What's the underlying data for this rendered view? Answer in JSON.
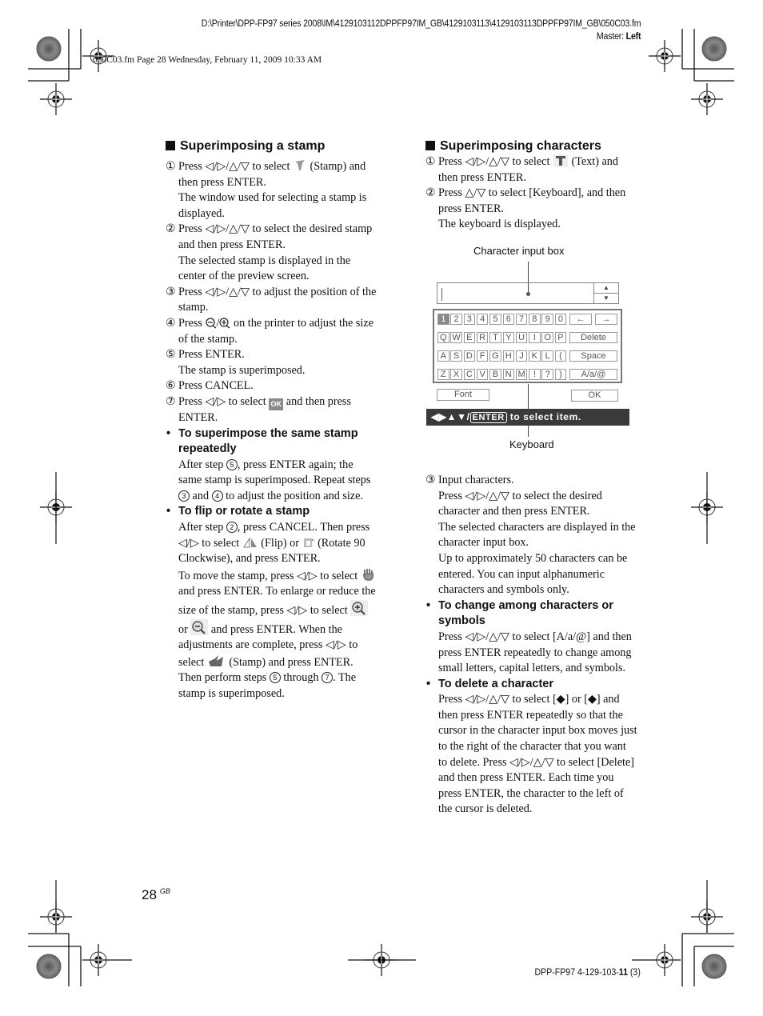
{
  "header": {
    "file_path": "D:\\Printer\\DPP-FP97 series 2008\\IM\\4129103112DPPFP97IM_GB\\4129103113\\4129103113DPPFP97IM_GB\\050C03.fm",
    "master_label": "Master:",
    "master_value": "Left",
    "frame_info": "050C03.fm  Page 28  Wednesday, February 11, 2009  10:33 AM"
  },
  "left_section": {
    "title": "Superimposing a stamp",
    "steps": [
      {
        "num": "①",
        "pre": "Press ◁/▷/△/▽ to select",
        "icon": "stamp-icon",
        "post": "(Stamp) and then press ENTER.",
        "note": "The window used for selecting a stamp is displayed."
      },
      {
        "num": "②",
        "text": "Press ◁/▷/△/▽ to select the desired stamp and then press ENTER.",
        "note": "The selected stamp is displayed in the center of the preview screen."
      },
      {
        "num": "③",
        "text": "Press ◁/▷/△/▽ to adjust the position of the stamp."
      },
      {
        "num": "④",
        "pre": "Press",
        "icon": "zoom-out-in-icon",
        "post": "on the printer to adjust the size of the stamp."
      },
      {
        "num": "⑤",
        "text": "Press ENTER.",
        "note": "The stamp is superimposed."
      },
      {
        "num": "⑥",
        "text": "Press CANCEL."
      },
      {
        "num": "⑦",
        "pre": "Press ◁/▷ to select",
        "icon_label": "OK",
        "post": "and then press ENTER."
      }
    ],
    "tips": [
      {
        "heading": "To superimpose the same stamp repeatedly",
        "body_1": "After step",
        "ref_a": "5",
        "body_2": ", press  ENTER again; the same stamp is superimposed. Repeat steps",
        "ref_b": "3",
        "body_3": "and",
        "ref_c": "4",
        "body_4": "to adjust the position and size."
      },
      {
        "heading": "To flip or rotate a stamp",
        "p1_a": "After step",
        "p1_ref": "2",
        "p1_b": ", press CANCEL. Then press ◁/▷ to select",
        "p1_c": "(Flip) or",
        "p1_d": "(Rotate 90 Clockwise), and press ENTER.",
        "p2_a": "To move the stamp, press ◁/▷ to select",
        "p2_b": "and press ENTER. To enlarge or reduce the size of the stamp,  press ◁/▷ to select",
        "p2_c": "or",
        "p2_d": "and press ENTER. When the adjustments are complete, press ◁/▷ to select",
        "p2_e": "(Stamp) and press ENTER. Then perform steps",
        "p2_ref1": "5",
        "p2_f": "through",
        "p2_ref2": "7",
        "p2_g": ". The stamp is superimposed."
      }
    ]
  },
  "right_section": {
    "title": "Superimposing characters",
    "step1_pre": "Press ◁/▷/△/▽ to select",
    "step1_post": "(Text) and then press ENTER.",
    "step2": "Press △/▽ to select [Keyboard], and then press ENTER.",
    "step2_note": "The keyboard is displayed.",
    "step3": "Input characters.",
    "step3_notes": [
      "Press ◁/▷/△/▽ to select the desired character and then press ENTER.",
      "The selected characters are displayed in the character input box.",
      "Up to approximately 50 characters can be entered. You can input alphanumeric characters and symbols only."
    ],
    "tips": [
      {
        "heading": "To change among characters or symbols",
        "body": "Press ◁/▷/△/▽ to select [A/a/@]  and then press ENTER repeatedly to change among small letters, capital letters, and symbols."
      },
      {
        "heading": "To delete a character",
        "body": "Press ◁/▷/△/▽ to select [◆] or [◆] and then press ENTER repeatedly so that the cursor in the character input box moves just to the right of the character that you want to delete. Press ◁/▷/△/▽ to select [Delete] and then press ENTER. Each time you press ENTER, the character to the left of the cursor is deleted."
      }
    ]
  },
  "diagram": {
    "label_input_box": "Character input box",
    "label_keyboard": "Keyboard",
    "spin_up": "▲",
    "spin_down": "▼",
    "rows": [
      [
        "1",
        "2",
        "3",
        "4",
        "5",
        "6",
        "7",
        "8",
        "9",
        "0"
      ],
      [
        "Q",
        "W",
        "E",
        "R",
        "T",
        "Y",
        "U",
        "I",
        "O",
        "P"
      ],
      [
        "A",
        "S",
        "D",
        "F",
        "G",
        "H",
        "J",
        "K",
        "L",
        "("
      ],
      [
        "Z",
        "X",
        "C",
        "V",
        "B",
        "N",
        "M",
        "!",
        "?",
        ")"
      ]
    ],
    "selected_key": "1",
    "arrow_left": "←",
    "arrow_right": "→",
    "delete": "Delete",
    "space": "Space",
    "case": "A/a/@",
    "font": "Font",
    "ok": "OK",
    "status_arrows": "◀▶▲▼/",
    "status_enter": "ENTER",
    "status_text": " to select item."
  },
  "footer": {
    "page_number": "28",
    "page_suffix": "GB",
    "doc_id_prefix": "DPP-FP97 4-129-103-",
    "doc_id_bold": "11",
    "doc_id_suffix": " (3)"
  }
}
